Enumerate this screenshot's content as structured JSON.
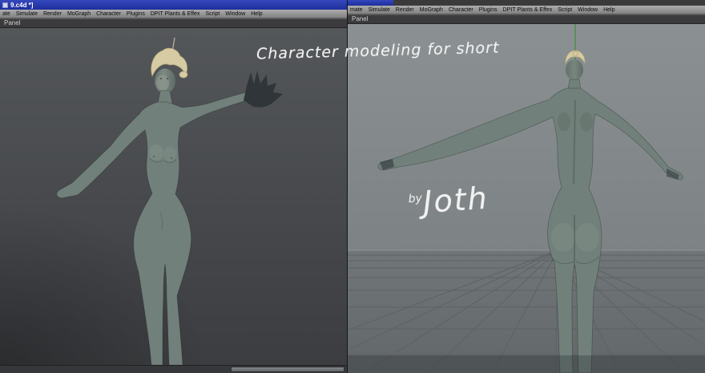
{
  "overlay": {
    "caption": "Character modeling for short",
    "byline_prefix": "by",
    "byline_name": "Joth"
  },
  "left_window": {
    "title": "9.c4d *]",
    "panel_tab": "Panel",
    "menu": [
      "ate",
      "Simulate",
      "Render",
      "MoGraph",
      "Character",
      "Plugins",
      "DPIT Plants & Effex",
      "Script",
      "Window",
      "Help"
    ]
  },
  "right_window": {
    "panel_tab": "Panel",
    "menu": [
      "mate",
      "Simulate",
      "Render",
      "MoGraph",
      "Character",
      "Plugins",
      "DPIT Plants & Effex",
      "Script",
      "Window",
      "Help"
    ]
  },
  "colors": {
    "titlebar": "#1d2e9b",
    "menubar": "#9a9a9a",
    "tabbar": "#3b3b3d",
    "viewport_left": "#46484c",
    "viewport_right": "#7d8385",
    "body": "#71807a",
    "hair": "#d6cba2",
    "axis_green": "#3f8f3f",
    "handwriting": "#f2f2f2"
  }
}
